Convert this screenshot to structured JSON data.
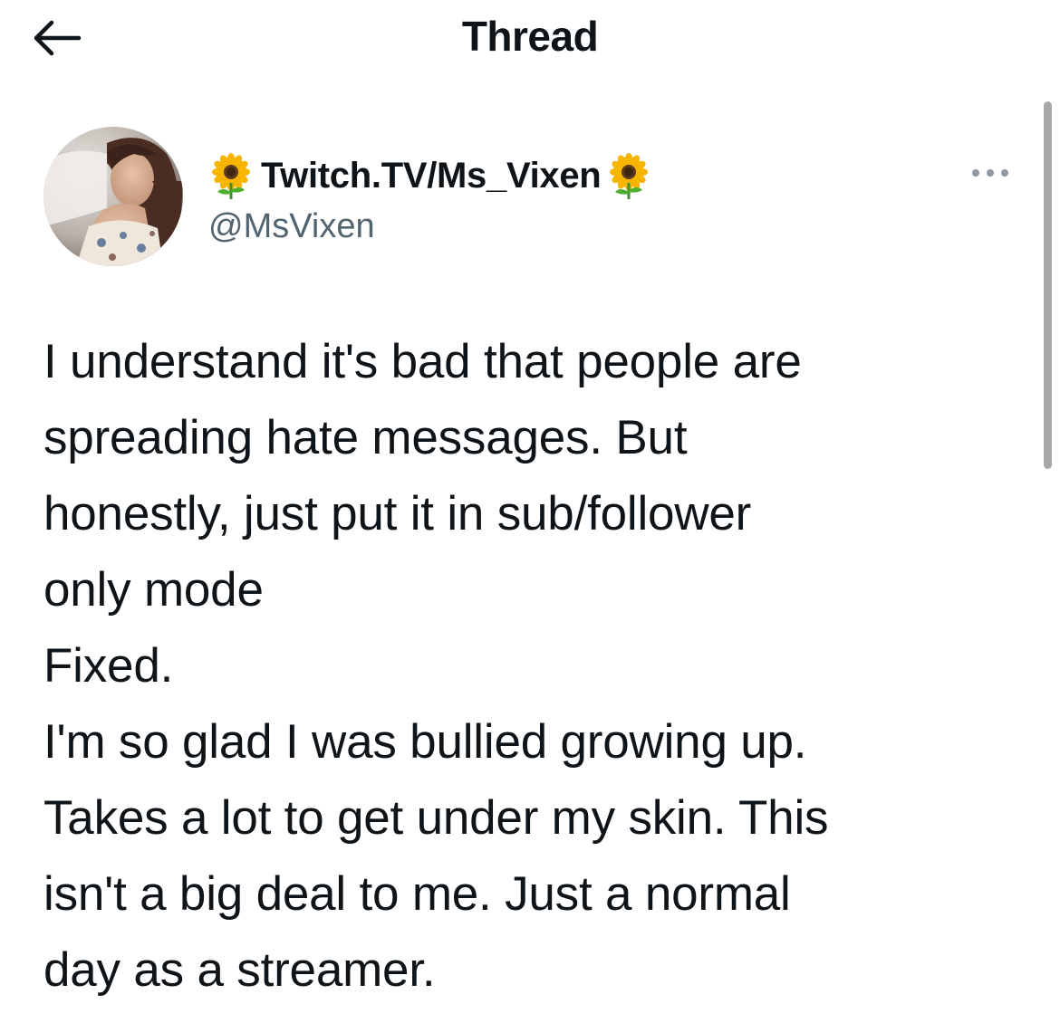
{
  "header": {
    "title": "Thread",
    "back_icon": "arrow-left-icon"
  },
  "tweet": {
    "author": {
      "display_name": "Twitch.TV/Ms_Vixen",
      "handle": "@MsVixen",
      "name_emoji": "sunflower-icon"
    },
    "more_icon": "more-horizontal-icon",
    "lines": [
      "I understand it's bad that people are",
      "spreading hate messages. But",
      "honestly, just put it in sub/follower",
      "only mode",
      "Fixed.",
      "I'm so glad I was bullied growing up.",
      "Takes a lot to get under my skin. This",
      "isn't a big deal to me. Just a normal",
      "day as a streamer."
    ]
  },
  "colors": {
    "text_primary": "#0f1419",
    "text_secondary": "#536471",
    "background": "#ffffff",
    "scrollbar": "#a9a9a9"
  }
}
